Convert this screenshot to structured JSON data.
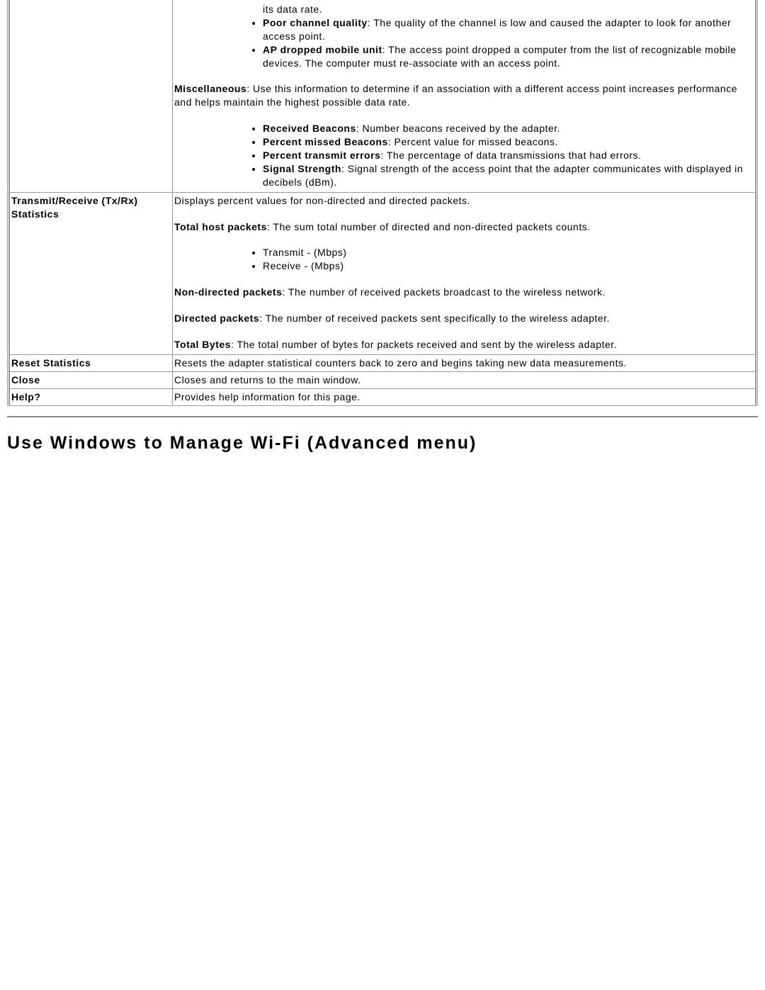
{
  "row0": {
    "term": "",
    "list1": {
      "tail0": "its data rate.",
      "b1": "Poor channel quality",
      "t1": ": The quality of the channel is low and caused the adapter to look for another access point.",
      "b2": "AP dropped mobile unit",
      "t2": ": The access point dropped a computer from the list of recognizable mobile devices. The computer must re-associate with an access point."
    },
    "misc_b": "Miscellaneous",
    "misc_t": ": Use this information to determine if an association with a different access point increases performance and helps maintain the highest possible data rate.",
    "list2": {
      "b0": "Received Beacons",
      "t0": ": Number beacons received by the adapter.",
      "b1": "Percent missed Beacons",
      "t1": ": Percent value for missed beacons.",
      "b2": "Percent transmit errors",
      "t2": ": The percentage of data transmissions that had errors.",
      "b3": "Signal Strength",
      "t3": ": Signal strength of the access point that the adapter communicates with displayed in decibels (dBm)."
    }
  },
  "row1": {
    "term": "Transmit/Receive (Tx/Rx) Statistics",
    "intro": "Displays percent values for non-directed and directed packets.",
    "thp_b": "Total host packets",
    "thp_t": ": The sum total number of directed and non-directed packets counts.",
    "items": {
      "tx": "Transmit - (Mbps)",
      "rx": "Receive - (Mbps)"
    },
    "ndp_b": "Non-directed packets",
    "ndp_t": ": The number of received packets broadcast to the wireless network.",
    "dp_b": "Directed packets",
    "dp_t": ": The number of received packets sent specifically to the wireless adapter.",
    "tb_b": "Total Bytes",
    "tb_t": ": The total number of bytes for packets received and sent by the wireless adapter."
  },
  "row2": {
    "term": "Reset Statistics",
    "desc": "Resets the adapter statistical counters back to zero and begins taking new data measurements."
  },
  "row3": {
    "term": "Close",
    "desc": "Closes and returns to the main window."
  },
  "row4": {
    "term": "Help?",
    "desc": "Provides help information for this page."
  },
  "heading": "Use Windows to Manage Wi-Fi (Advanced menu)"
}
